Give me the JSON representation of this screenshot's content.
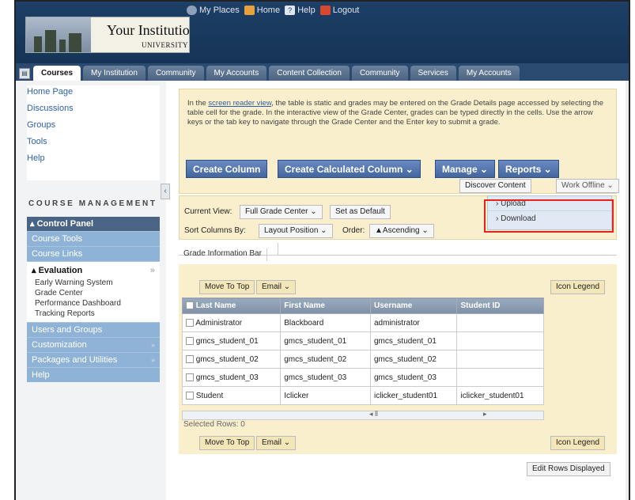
{
  "header": {
    "institution_name": "Your Institution",
    "institution_sub": "UNIVERSITY",
    "links": [
      "My Places",
      "Home",
      "Help",
      "Logout"
    ]
  },
  "tabs": [
    "Courses",
    "My Institution",
    "Community",
    "My Accounts",
    "Content Collection",
    "Community",
    "Services",
    "My Accounts"
  ],
  "sidebar": {
    "menu": [
      "Home Page",
      "Discussions",
      "Groups",
      "Tools",
      "Help"
    ],
    "course_management": "COURSE MANAGEMENT",
    "control_panel": "Control Panel",
    "items_top": [
      "Course Tools",
      "Course Links"
    ],
    "evaluation": "Evaluation",
    "evaluation_items": [
      "Early Warning System",
      "Grade Center",
      "Performance Dashboard",
      "Tracking Reports"
    ],
    "items_bottom": [
      "Users and Groups",
      "Customization",
      "Packages and Utilities",
      "Help"
    ]
  },
  "info_text": {
    "pre": "In the ",
    "link": "screen reader view",
    "post": ", the table is static and grades may be entered on the Grade Details page accessed by selecting the table cell for the grade. In the interactive view of the Grade Center, grades can be typed directly in the cells. Use the arrow keys or the tab key to navigate through the Grade Center and the Enter key to submit a grade."
  },
  "toolbar": {
    "create_column": "Create Column",
    "create_calculated": "Create Calculated Column",
    "manage": "Manage",
    "reports": "Reports",
    "discover_content": "Discover Content",
    "work_offline": "Work Offline"
  },
  "work_offline_menu": [
    "Upload",
    "Download"
  ],
  "view_bar": {
    "current_view_label": "Current View:",
    "current_view_value": "Full Grade Center",
    "set_default": "Set as Default",
    "sort_label": "Sort Columns By:",
    "sort_value": "Layout Position",
    "order_label": "Order:",
    "order_value": "Ascending"
  },
  "grade_info_tab": "Grade Information Bar",
  "actions": {
    "move_to_top": "Move To Top",
    "email": "Email",
    "icon_legend": "Icon Legend",
    "edit_rows": "Edit Rows Displayed"
  },
  "table": {
    "columns": [
      "Last Name",
      "First Name",
      "Username",
      "Student ID"
    ],
    "rows": [
      [
        "Administrator",
        "Blackboard",
        "administrator",
        ""
      ],
      [
        "gmcs_student_01",
        "gmcs_student_01",
        "gmcs_student_01",
        ""
      ],
      [
        "gmcs_student_02",
        "gmcs_student_02",
        "gmcs_student_02",
        ""
      ],
      [
        "gmcs_student_03",
        "gmcs_student_03",
        "gmcs_student_03",
        ""
      ],
      [
        "Student",
        "Iclicker",
        "iclicker_student01",
        "iclicker_student01"
      ]
    ],
    "selected_rows": "Selected Rows: 0"
  }
}
